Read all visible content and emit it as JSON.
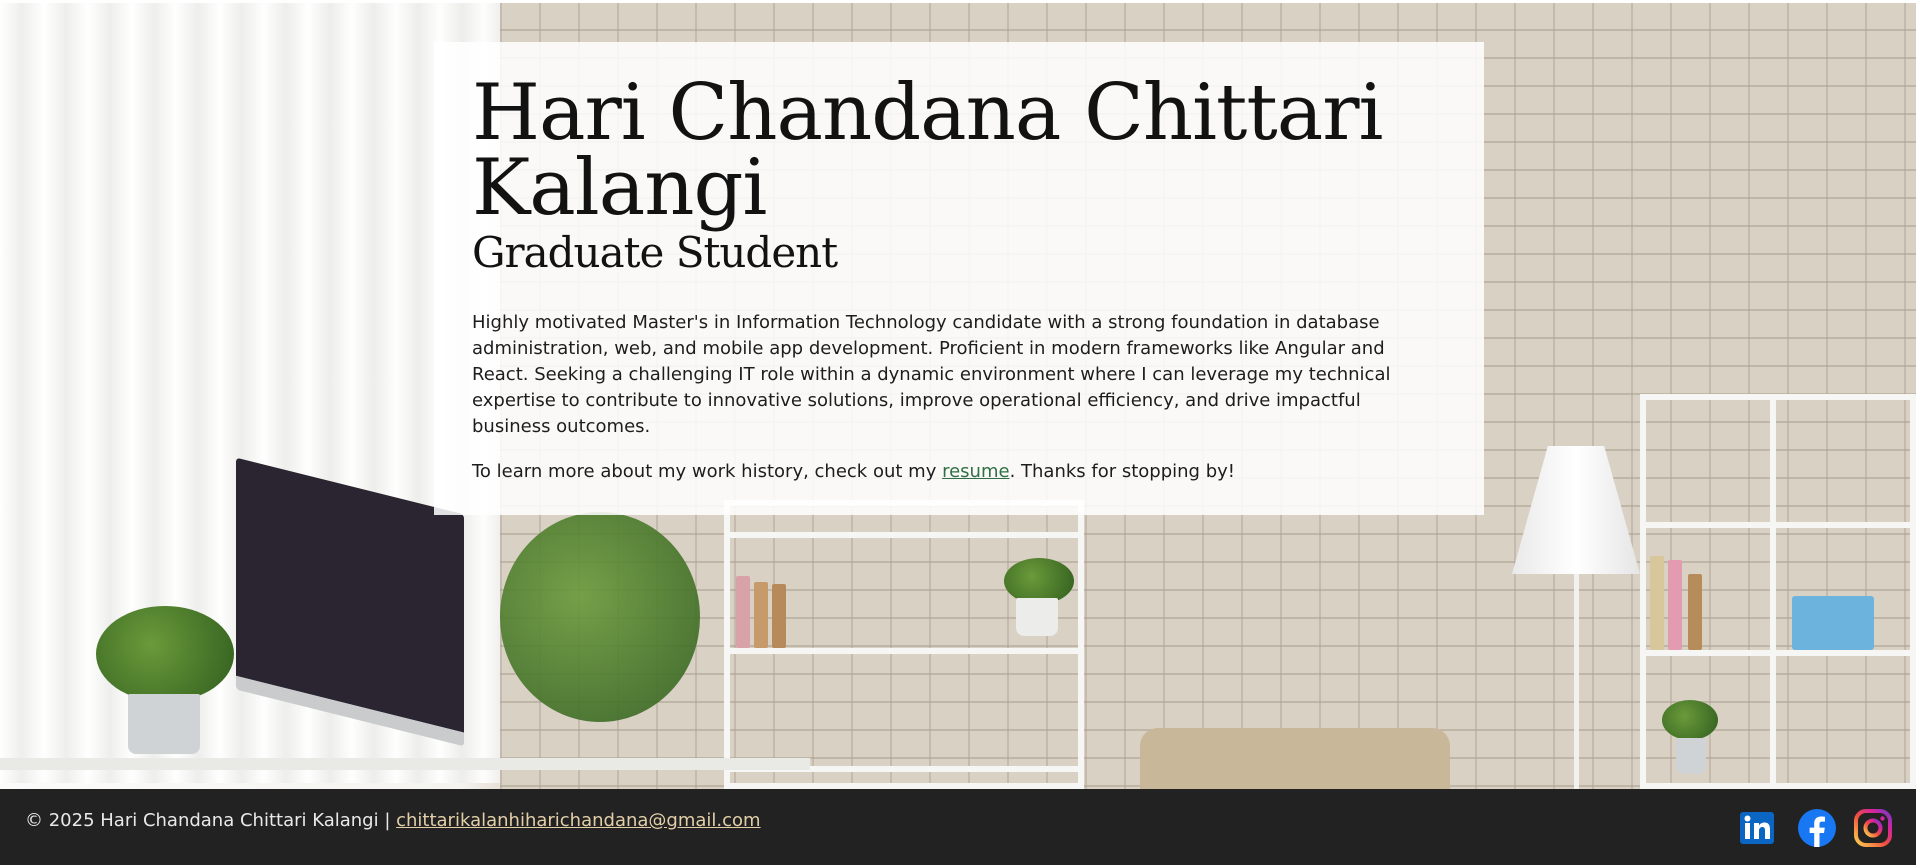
{
  "hero": {
    "name": "Hari Chandana Chittari Kalangi",
    "subtitle": "Graduate Student",
    "bio": "Highly motivated Master's in Information Technology candidate with a strong foundation in database administration, web, and mobile app development. Proficient in modern frameworks like Angular and React. Seeking a challenging IT role within a dynamic environment where I can leverage my technical expertise to contribute to innovative solutions, improve operational efficiency, and drive impactful business outcomes.",
    "cta_before": "To learn more about my work history, check out my ",
    "cta_link": "resume",
    "cta_after": ". Thanks for stopping by!"
  },
  "footer": {
    "copyright": "© 2025 Hari Chandana Chittari Kalangi | ",
    "email": "chittarikalanhiharichandana@gmail.com",
    "social": [
      {
        "icon": "linkedin-icon",
        "color": "#0a66c2"
      },
      {
        "icon": "facebook-icon",
        "color": "#1877f2"
      },
      {
        "icon": "instagram-icon",
        "color": "#e1306c"
      }
    ]
  },
  "colors": {
    "link": "#2f6f43",
    "footer_bg": "#222222",
    "footer_link": "#e2cfa8"
  }
}
